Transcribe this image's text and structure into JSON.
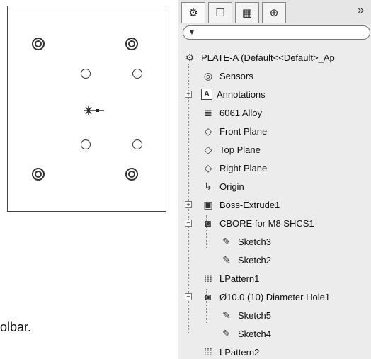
{
  "panel": {
    "tabs": [
      {
        "name": "feature-manager",
        "glyph": "⚙"
      },
      {
        "name": "property-manager",
        "glyph": "☐"
      },
      {
        "name": "configuration-manager",
        "glyph": "▦"
      },
      {
        "name": "dimxpert-manager",
        "glyph": "⊕"
      }
    ],
    "more": "»",
    "filter_icon": "▼",
    "tree": [
      {
        "id": "part",
        "label": "PLATE-A  (Default<<Default>_Ap",
        "icon": "part-icon",
        "glyph": "⚙"
      },
      {
        "id": "sensors",
        "label": "Sensors",
        "icon": "sensors-icon",
        "glyph": "◎"
      },
      {
        "id": "annotations",
        "label": "Annotations",
        "icon": "annotations-icon",
        "glyph": "A"
      },
      {
        "id": "material",
        "label": "6061 Alloy",
        "icon": "material-icon",
        "glyph": "≣"
      },
      {
        "id": "front-plane",
        "label": "Front Plane",
        "icon": "plane-icon",
        "glyph": "◇"
      },
      {
        "id": "top-plane",
        "label": "Top Plane",
        "icon": "plane-icon",
        "glyph": "◇"
      },
      {
        "id": "right-plane",
        "label": "Right Plane",
        "icon": "plane-icon",
        "glyph": "◇"
      },
      {
        "id": "origin",
        "label": "Origin",
        "icon": "origin-icon",
        "glyph": "↳"
      },
      {
        "id": "boss-extrude1",
        "label": "Boss-Extrude1",
        "icon": "extrude-icon",
        "glyph": "▣"
      },
      {
        "id": "cbore",
        "label": "CBORE for M8 SHCS1",
        "icon": "hole-wizard-icon",
        "glyph": "◙"
      },
      {
        "id": "sketch3",
        "label": "Sketch3",
        "icon": "sketch-icon",
        "glyph": "✎"
      },
      {
        "id": "sketch2",
        "label": "Sketch2",
        "icon": "sketch-icon",
        "glyph": "✎"
      },
      {
        "id": "lpattern1",
        "label": "LPattern1",
        "icon": "linear-pattern-icon",
        "glyph": "⁞⁞⁞"
      },
      {
        "id": "diameter-hole1",
        "label": "Ø10.0 (10) Diameter Hole1",
        "icon": "hole-wizard-icon",
        "glyph": "◙"
      },
      {
        "id": "sketch5",
        "label": "Sketch5",
        "icon": "sketch-icon",
        "glyph": "✎"
      },
      {
        "id": "sketch4",
        "label": "Sketch4",
        "icon": "sketch-icon",
        "glyph": "✎"
      },
      {
        "id": "lpattern2",
        "label": "LPattern2",
        "icon": "linear-pattern-icon",
        "glyph": "⁞⁞⁞"
      }
    ]
  },
  "drawing": {
    "side_text": "olbar."
  }
}
